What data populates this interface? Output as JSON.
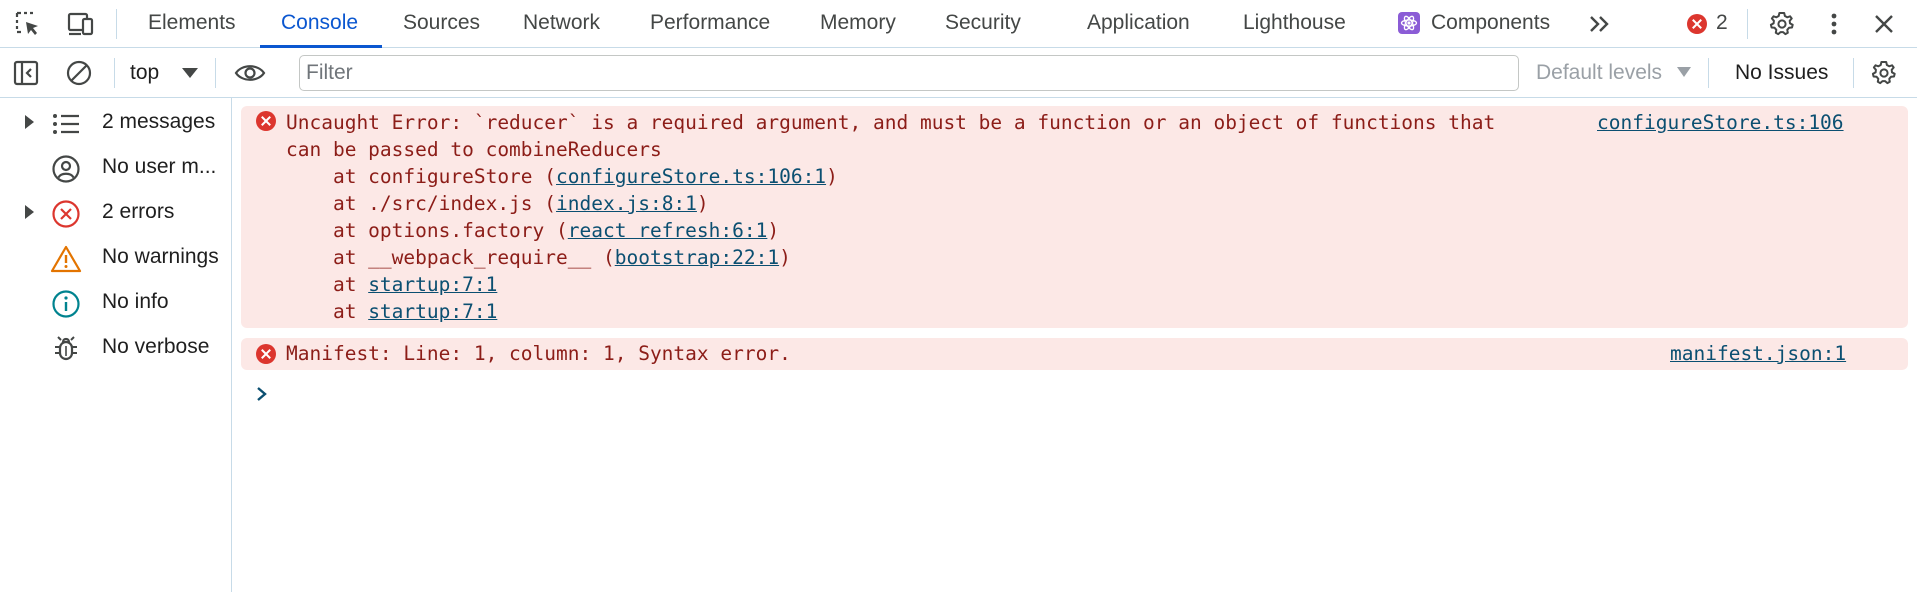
{
  "tabs": {
    "elements": "Elements",
    "console": "Console",
    "sources": "Sources",
    "network": "Network",
    "performance": "Performance",
    "memory": "Memory",
    "security": "Security",
    "application": "Application",
    "lighthouse": "Lighthouse",
    "components": "Components",
    "active": "Console",
    "error_count": "2"
  },
  "toolbar": {
    "context": "top",
    "filter_placeholder": "Filter",
    "levels": "Default levels",
    "issues": "No Issues"
  },
  "sidebar": {
    "items": [
      {
        "label": "2 messages",
        "icon": "list-icon",
        "expandable": true
      },
      {
        "label": "No user m...",
        "icon": "user-icon",
        "expandable": false
      },
      {
        "label": "2 errors",
        "icon": "error-icon",
        "expandable": true
      },
      {
        "label": "No warnings",
        "icon": "warning-icon",
        "expandable": false
      },
      {
        "label": "No info",
        "icon": "info-icon",
        "expandable": false
      },
      {
        "label": "No verbose",
        "icon": "bug-icon",
        "expandable": false
      }
    ]
  },
  "messages": {
    "error1": {
      "line1": "Uncaught Error: `reducer` is a required argument, and must be a function or an object of functions that",
      "line2": "can be passed to combineReducers",
      "stack": [
        {
          "prefix": "    at configureStore (",
          "link": "configureStore.ts:106:1",
          "suffix": ")"
        },
        {
          "prefix": "    at ./src/index.js (",
          "link": "index.js:8:1",
          "suffix": ")"
        },
        {
          "prefix": "    at options.factory (",
          "link": "react refresh:6:1",
          "suffix": ")"
        },
        {
          "prefix": "    at __webpack_require__ (",
          "link": "bootstrap:22:1",
          "suffix": ")"
        },
        {
          "prefix": "    at ",
          "link": "startup:7:1",
          "suffix": ""
        },
        {
          "prefix": "    at ",
          "link": "startup:7:1",
          "suffix": ""
        }
      ],
      "source": "configureStore.ts:106"
    },
    "error2": {
      "text": "Manifest: Line: 1, column: 1, Syntax error.",
      "source": "manifest.json:1"
    }
  },
  "colors": {
    "accent": "#0b57d0",
    "error": "#dc362e",
    "error_bg": "#fce8e6",
    "error_text": "#8c1d18",
    "link": "#0b4f71"
  }
}
